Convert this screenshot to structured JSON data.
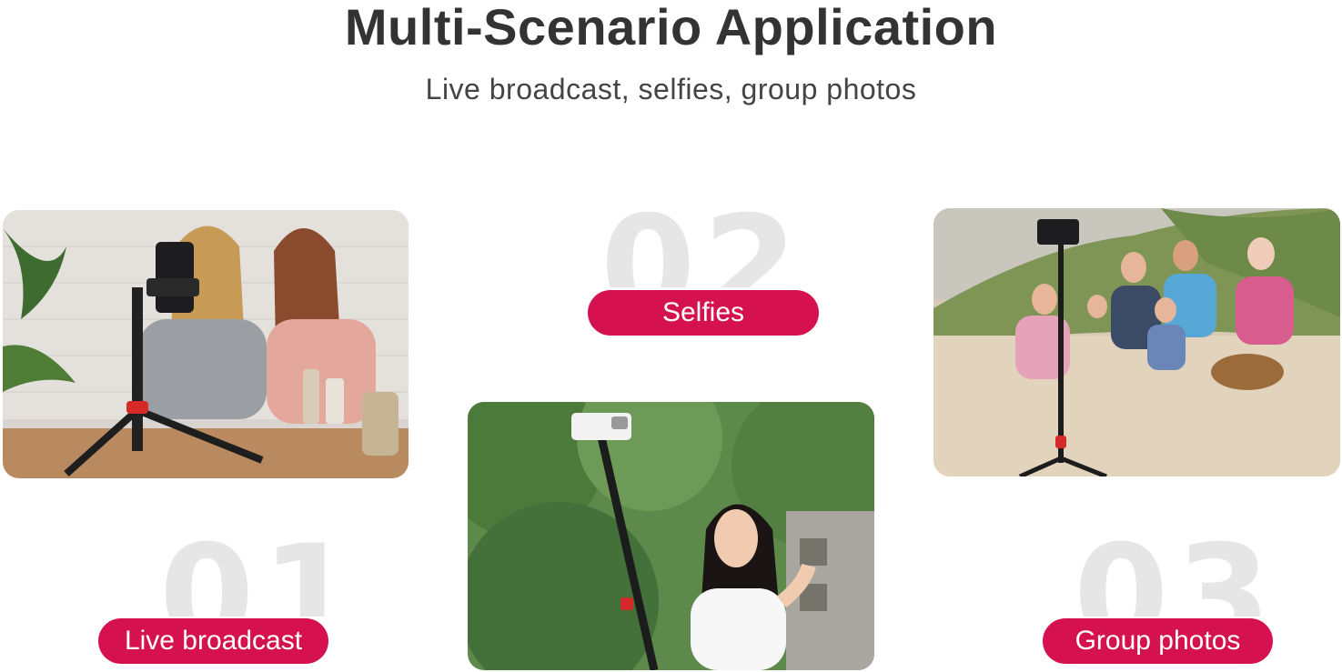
{
  "header": {
    "title": "Multi-Scenario Application",
    "subtitle": "Live broadcast, selfies, group photos"
  },
  "scenarios": [
    {
      "number": "01",
      "label": "Live broadcast",
      "image": "makeup-live-broadcast-photo"
    },
    {
      "number": "02",
      "label": "Selfies",
      "image": "selfie-stick-photo"
    },
    {
      "number": "03",
      "label": "Group photos",
      "image": "beach-family-group-photo"
    }
  ],
  "colors": {
    "accent": "#d5124f",
    "title": "#333333",
    "number_watermark": "#e6e6e6"
  }
}
